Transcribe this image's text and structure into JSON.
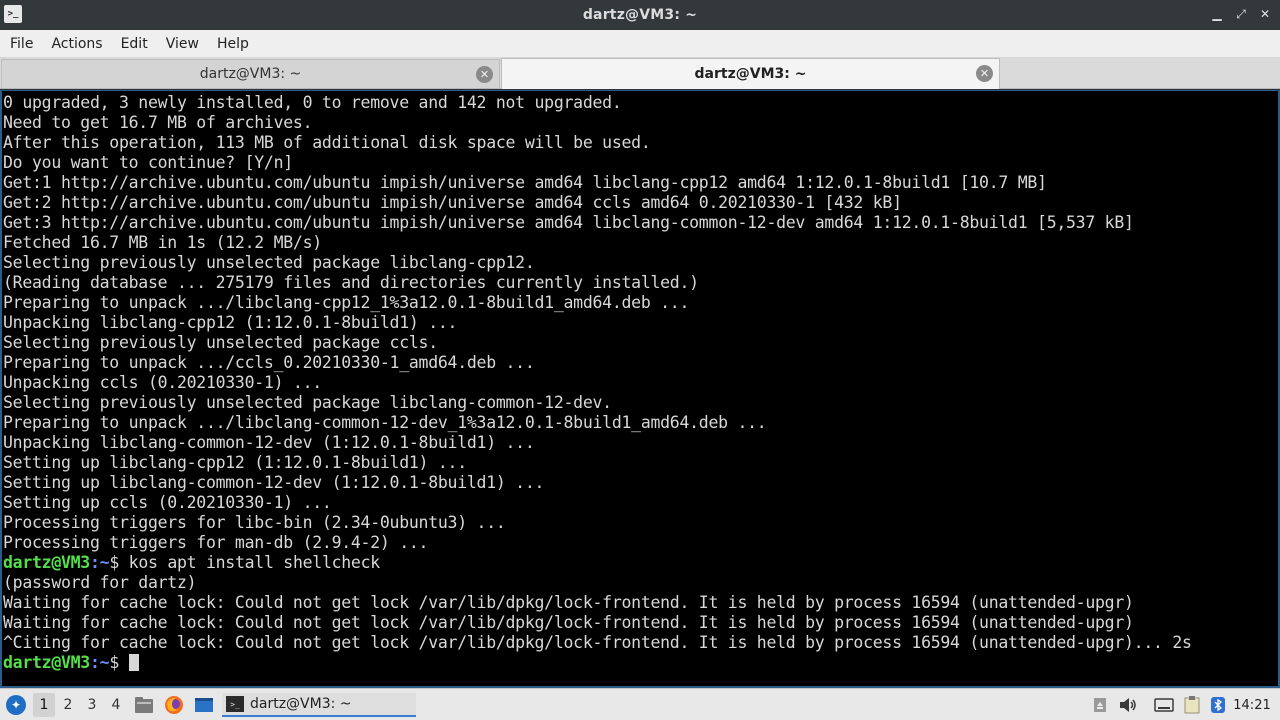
{
  "window": {
    "title": "dartz@VM3: ~",
    "app_icon_glyph": ">_"
  },
  "menu": {
    "items": [
      "File",
      "Actions",
      "Edit",
      "View",
      "Help"
    ]
  },
  "tabs": [
    {
      "label": "dartz@VM3: ~",
      "active": false
    },
    {
      "label": "dartz@VM3: ~",
      "active": true
    }
  ],
  "terminal": {
    "output_lines": [
      "0 upgraded, 3 newly installed, 0 to remove and 142 not upgraded.",
      "Need to get 16.7 MB of archives.",
      "After this operation, 113 MB of additional disk space will be used.",
      "Do you want to continue? [Y/n]",
      "Get:1 http://archive.ubuntu.com/ubuntu impish/universe amd64 libclang-cpp12 amd64 1:12.0.1-8build1 [10.7 MB]",
      "Get:2 http://archive.ubuntu.com/ubuntu impish/universe amd64 ccls amd64 0.20210330-1 [432 kB]",
      "Get:3 http://archive.ubuntu.com/ubuntu impish/universe amd64 libclang-common-12-dev amd64 1:12.0.1-8build1 [5,537 kB]",
      "Fetched 16.7 MB in 1s (12.2 MB/s)",
      "Selecting previously unselected package libclang-cpp12.",
      "(Reading database ... 275179 files and directories currently installed.)",
      "Preparing to unpack .../libclang-cpp12_1%3a12.0.1-8build1_amd64.deb ...",
      "Unpacking libclang-cpp12 (1:12.0.1-8build1) ...",
      "Selecting previously unselected package ccls.",
      "Preparing to unpack .../ccls_0.20210330-1_amd64.deb ...",
      "Unpacking ccls (0.20210330-1) ...",
      "Selecting previously unselected package libclang-common-12-dev.",
      "Preparing to unpack .../libclang-common-12-dev_1%3a12.0.1-8build1_amd64.deb ...",
      "Unpacking libclang-common-12-dev (1:12.0.1-8build1) ...",
      "Setting up libclang-cpp12 (1:12.0.1-8build1) ...",
      "Setting up libclang-common-12-dev (1:12.0.1-8build1) ...",
      "Setting up ccls (0.20210330-1) ...",
      "Processing triggers for libc-bin (2.34-0ubuntu3) ...",
      "Processing triggers for man-db (2.9.4-2) ..."
    ],
    "prompt_user": "dartz@VM3",
    "prompt_sep": ":",
    "prompt_path": "~",
    "prompt_symbol": "$",
    "command": " kos apt install shellcheck",
    "after_command_lines": [
      "(password for dartz)",
      "Waiting for cache lock: Could not get lock /var/lib/dpkg/lock-frontend. It is held by process 16594 (unattended-upgr)",
      "Waiting for cache lock: Could not get lock /var/lib/dpkg/lock-frontend. It is held by process 16594 (unattended-upgr)",
      "^Citing for cache lock: Could not get lock /var/lib/dpkg/lock-frontend. It is held by process 16594 (unattended-upgr)... 2s"
    ],
    "colors": {
      "prompt_user": "#54e04a",
      "prompt_path": "#6a8cff",
      "text": "#d8d8d8",
      "background": "#000000"
    }
  },
  "taskbar": {
    "workspaces": [
      "1",
      "2",
      "3",
      "4"
    ],
    "active_workspace": "1",
    "launchers": [
      "file-manager-icon",
      "firefox-icon",
      "desktop-icon"
    ],
    "task_label": "dartz@VM3: ~",
    "tray_icons": [
      "removable-media-icon",
      "volume-icon",
      "keyboard-icon",
      "clipboard-icon",
      "bluetooth-icon"
    ],
    "clock": "14:21"
  }
}
